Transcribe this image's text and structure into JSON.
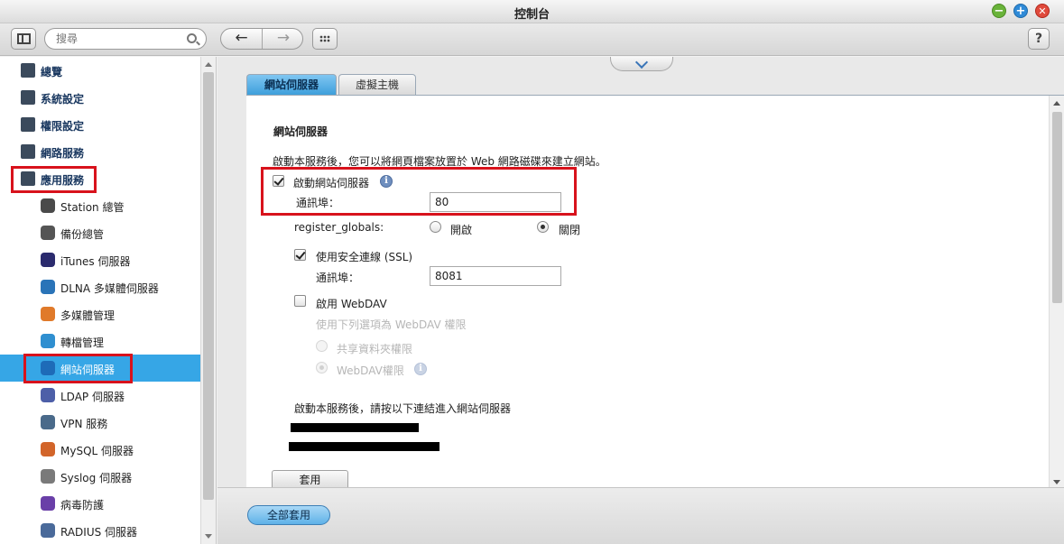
{
  "window": {
    "title": "控制台"
  },
  "toolbar": {
    "search_placeholder": "搜尋",
    "back_arrow": "←",
    "forward_arrow": "→",
    "help_label": "?"
  },
  "sidebar": {
    "top_items": [
      {
        "label": "總覽",
        "icon": "grid-icon",
        "color": "#3b4a5c"
      },
      {
        "label": "系統設定",
        "icon": "gear-icon",
        "color": "#3b4a5c"
      },
      {
        "label": "權限設定",
        "icon": "user-icon",
        "color": "#3b4a5c"
      },
      {
        "label": "網路服務",
        "icon": "globe-icon",
        "color": "#3b4a5c"
      },
      {
        "label": "應用服務",
        "icon": "tray-icon",
        "color": "#3b4a5c"
      }
    ],
    "sub_items": [
      {
        "label": "Station 總管",
        "icon": "station-icon",
        "color": "#4a4a4a"
      },
      {
        "label": "備份總管",
        "icon": "backup-icon",
        "color": "#555555"
      },
      {
        "label": "iTunes 伺服器",
        "icon": "itunes-icon",
        "color": "#2b2b6e"
      },
      {
        "label": "DLNA 多媒體伺服器",
        "icon": "dlna-icon",
        "color": "#2a74b8"
      },
      {
        "label": "多媒體管理",
        "icon": "multimedia-icon",
        "color": "#e07a2a"
      },
      {
        "label": "轉檔管理",
        "icon": "transcode-icon",
        "color": "#2f8fd0"
      },
      {
        "label": "網站伺服器",
        "icon": "web-server-icon",
        "color": "#1e6bb8"
      },
      {
        "label": "LDAP 伺服器",
        "icon": "ldap-icon",
        "color": "#4d5fa8"
      },
      {
        "label": "VPN 服務",
        "icon": "vpn-icon",
        "color": "#4a6a8a"
      },
      {
        "label": "MySQL 伺服器",
        "icon": "mysql-icon",
        "color": "#d2652a"
      },
      {
        "label": "Syslog 伺服器",
        "icon": "syslog-icon",
        "color": "#7a7a7a"
      },
      {
        "label": "病毒防護",
        "icon": "antivirus-icon",
        "color": "#6a3fa8"
      },
      {
        "label": "RADIUS 伺服器",
        "icon": "radius-icon",
        "color": "#4a6a9a"
      }
    ],
    "active_item": "網站伺服器"
  },
  "tabs": [
    {
      "label": "網站伺服器"
    },
    {
      "label": "虛擬主機"
    }
  ],
  "content": {
    "section_title": "網站伺服器",
    "description": "啟動本服務後，您可以將網頁檔案放置於 Web 網路磁碟來建立網站。",
    "enable_web_server": {
      "label": "啟動網站伺服器",
      "checked": true
    },
    "port": {
      "label": "通訊埠：",
      "value": "80"
    },
    "register_globals": {
      "label": "register_globals:",
      "on_label": "開啟",
      "off_label": "關閉",
      "selected": "關閉"
    },
    "ssl": {
      "label": "使用安全連線 (SSL)",
      "checked": true
    },
    "ssl_port": {
      "label": "通訊埠：",
      "value": "8081"
    },
    "webdav": {
      "label": "啟用 WebDAV",
      "checked": false
    },
    "webdav_hint": "使用下列選項為 WebDAV 權限",
    "webdav_share": "共享資料夾權限",
    "webdav_perm": "WebDAV權限",
    "link_hint": "啟動本服務後，請按以下連結進入網站伺服器",
    "apply_label": "套用"
  },
  "footer": {
    "apply_all_label": "全部套用"
  },
  "colors": {
    "accent": "#36a6e6",
    "highlight_box": "#d8121c"
  }
}
